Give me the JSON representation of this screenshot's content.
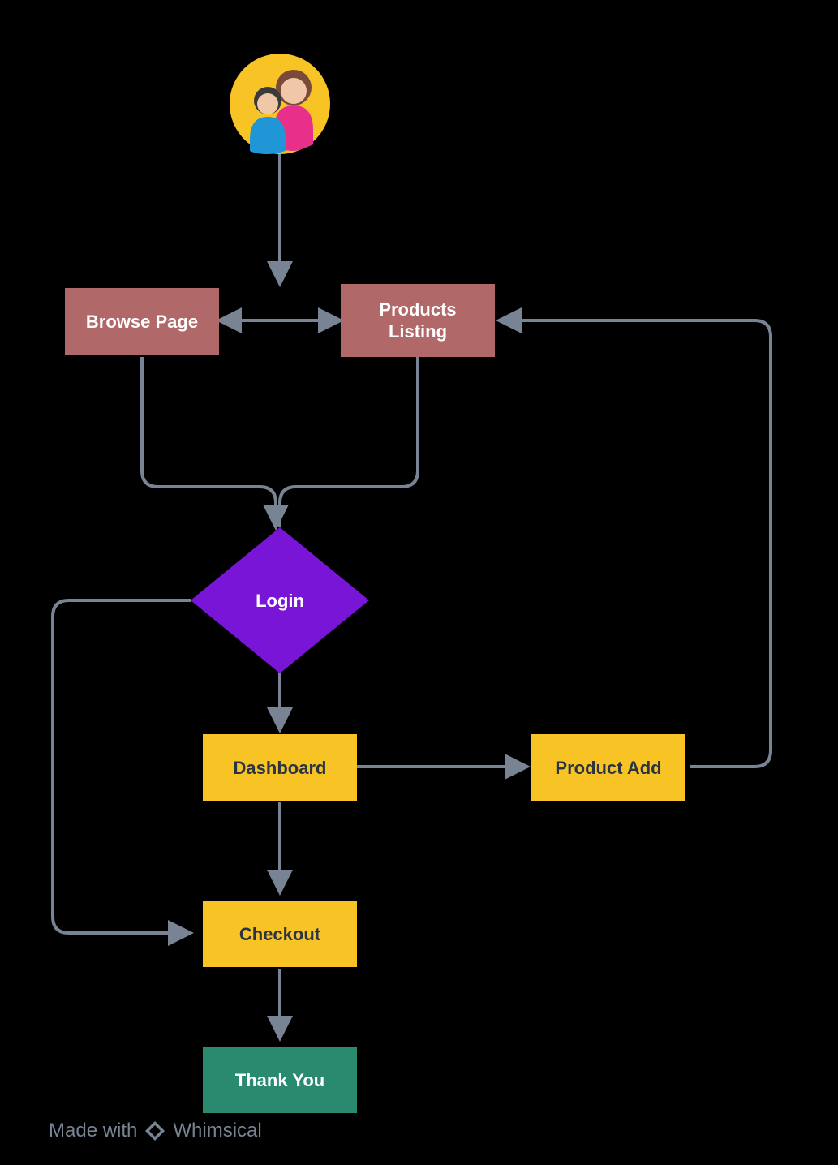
{
  "diagram": {
    "nodes": {
      "browse_page": {
        "label": "Browse Page",
        "shape": "rect",
        "fill": "#B06868"
      },
      "products_listing": {
        "label_line1": "Products",
        "label_line2": "Listing",
        "shape": "rect",
        "fill": "#B06868"
      },
      "login": {
        "label": "Login",
        "shape": "diamond",
        "fill": "#7915D6"
      },
      "dashboard": {
        "label": "Dashboard",
        "shape": "rect",
        "fill": "#F7C325"
      },
      "product_add": {
        "label": "Product Add",
        "shape": "rect",
        "fill": "#F7C325"
      },
      "checkout": {
        "label": "Checkout",
        "shape": "rect",
        "fill": "#F7C325"
      },
      "thank_you": {
        "label": "Thank You",
        "shape": "rect",
        "fill": "#2A8A6F"
      },
      "user_icon": {
        "shape": "circle",
        "fill": "#F7C325"
      }
    },
    "edges": [
      {
        "from": "user_icon",
        "to": "browse_page_products_listing_midpoint",
        "style": "arrow"
      },
      {
        "from": "browse_page",
        "to": "products_listing",
        "style": "double-arrow"
      },
      {
        "from": "browse_page",
        "to": "login",
        "style": "curve-down-right"
      },
      {
        "from": "products_listing",
        "to": "login",
        "style": "curve-down-left"
      },
      {
        "from": "login",
        "to": "dashboard",
        "style": "arrow"
      },
      {
        "from": "login",
        "to": "checkout",
        "style": "curve-left-down"
      },
      {
        "from": "dashboard",
        "to": "product_add",
        "style": "arrow"
      },
      {
        "from": "product_add",
        "to": "products_listing",
        "style": "curve-right-up"
      },
      {
        "from": "dashboard",
        "to": "checkout",
        "style": "arrow"
      },
      {
        "from": "checkout",
        "to": "thank_you",
        "style": "arrow"
      }
    ],
    "colors": {
      "arrow": "#788494",
      "text_dark": "#2b3440",
      "text_light": "#ffffff"
    }
  },
  "footer": {
    "made_with": "Made with",
    "brand": "Whimsical"
  }
}
